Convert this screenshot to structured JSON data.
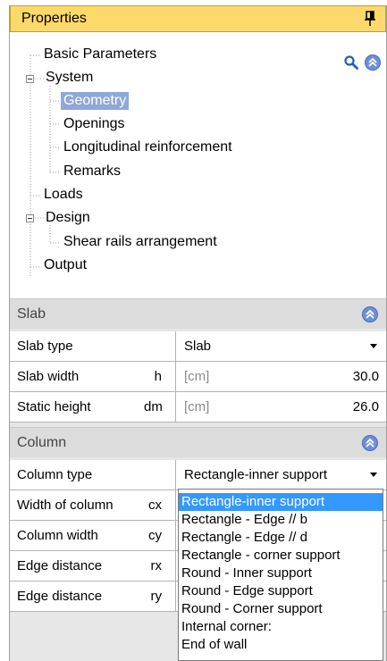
{
  "panel": {
    "title": "Properties"
  },
  "tree": {
    "items": [
      {
        "label": "Basic Parameters"
      },
      {
        "label": "System"
      },
      {
        "label": "Geometry"
      },
      {
        "label": "Openings"
      },
      {
        "label": "Longitudinal reinforcement"
      },
      {
        "label": "Remarks"
      },
      {
        "label": "Loads"
      },
      {
        "label": "Design"
      },
      {
        "label": "Shear rails arrangement"
      },
      {
        "label": "Output"
      }
    ],
    "selected": "Geometry"
  },
  "slab": {
    "header": "Slab",
    "rows": [
      {
        "label": "Slab type",
        "symbol": "",
        "value": "Slab"
      },
      {
        "label": "Slab width",
        "symbol": "h",
        "unit": "[cm]",
        "value": "30.0"
      },
      {
        "label": "Static height",
        "symbol": "dm",
        "unit": "[cm]",
        "value": "26.0"
      }
    ]
  },
  "column": {
    "header": "Column",
    "rows": [
      {
        "label": "Column type",
        "symbol": "",
        "value": "Rectangle-inner support"
      },
      {
        "label": "Width of column",
        "symbol": "cx"
      },
      {
        "label": "Column width",
        "symbol": "cy"
      },
      {
        "label": "Edge distance",
        "symbol": "rx"
      },
      {
        "label": "Edge distance",
        "symbol": "ry"
      }
    ]
  },
  "dropdown": {
    "options": [
      "Rectangle-inner support",
      "Rectangle - Edge // b",
      "Rectangle - Edge // d",
      "Rectangle - corner support",
      "Round - Inner support",
      "Round - Edge support",
      "Round - Corner support",
      "Internal corner:",
      "End of wall"
    ],
    "selected": "Rectangle-inner support"
  },
  "colors": {
    "title_bar": "#fcd96b",
    "selection": "#3399ff",
    "tree_selection": "#8fa8d8",
    "accent_icon": "#6f8fd6"
  },
  "icons": [
    "pin-icon",
    "search-icon",
    "collapse-chevron-icon",
    "dropdown-arrow-icon",
    "tree-expander-icon"
  ]
}
